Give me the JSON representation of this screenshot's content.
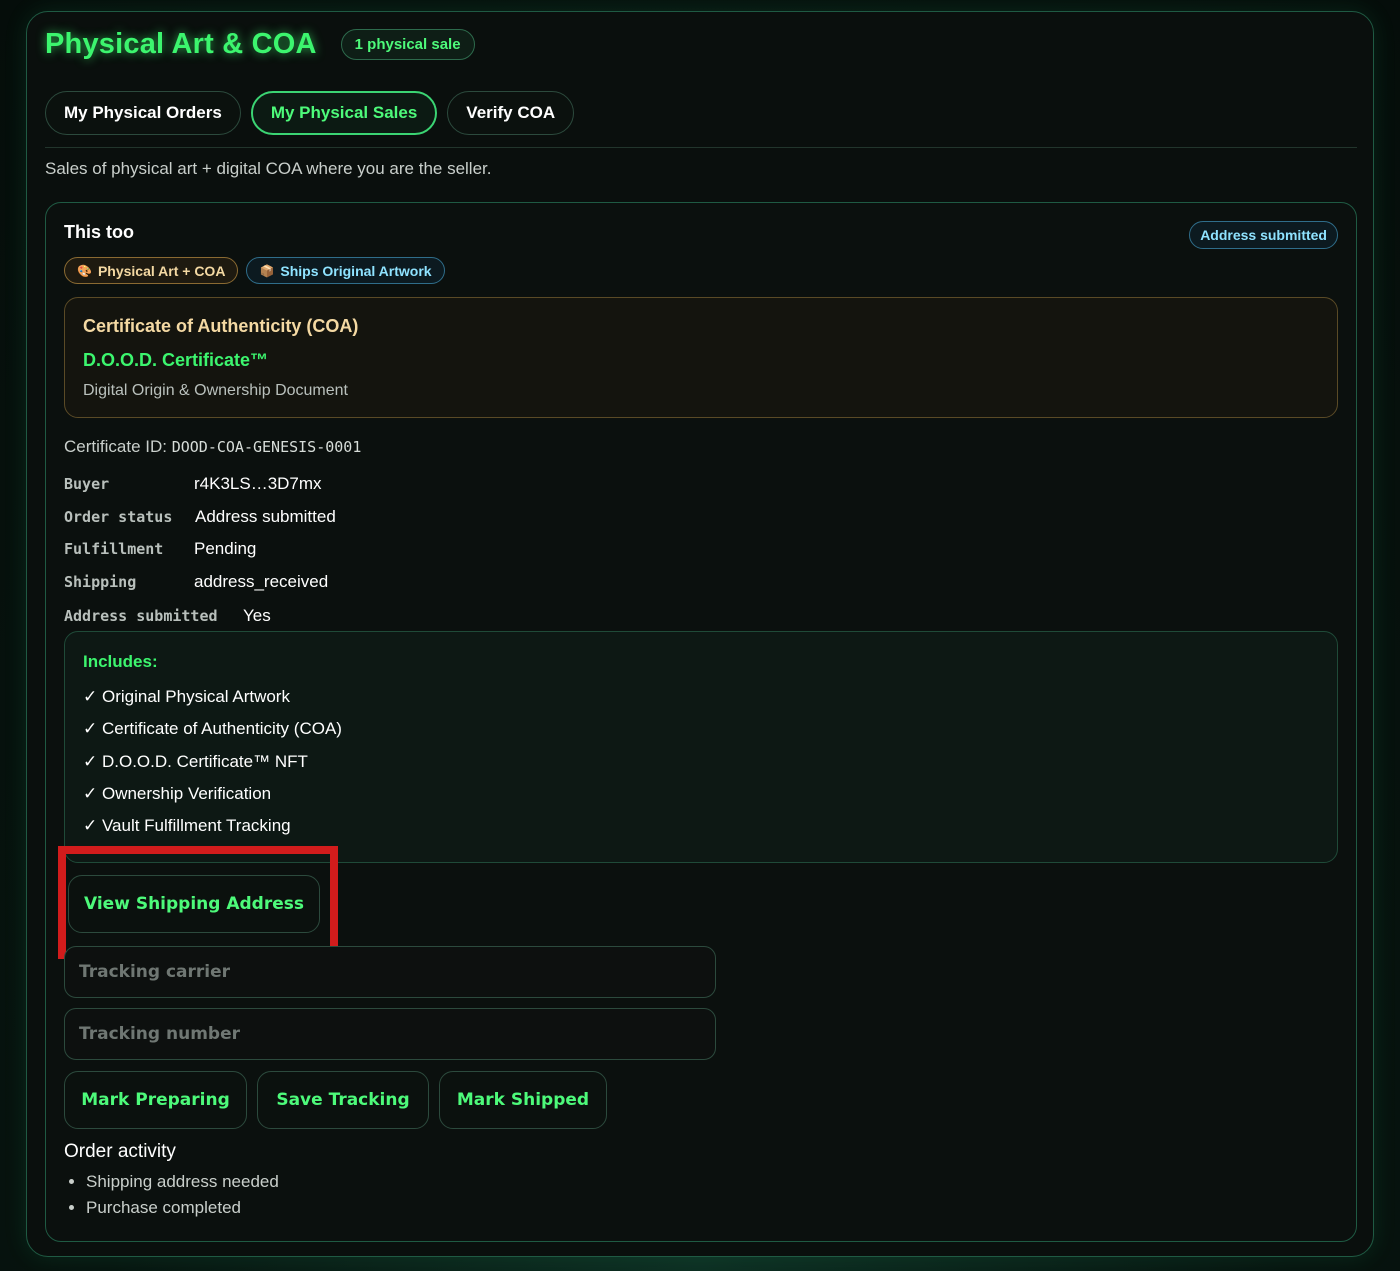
{
  "header": {
    "title": "Physical Art & COA",
    "count_badge": "1 physical sale"
  },
  "tabs": [
    {
      "label": "My Physical Orders",
      "active": false
    },
    {
      "label": "My Physical Sales",
      "active": true
    },
    {
      "label": "Verify COA",
      "active": false
    }
  ],
  "subtitle": "Sales of physical art + digital COA where you are the seller.",
  "sale": {
    "title": "This too",
    "status_badge": "Address submitted",
    "pills": [
      {
        "icon": "palette-icon",
        "glyph": "🎨",
        "label": "Physical Art + COA"
      },
      {
        "icon": "package-icon",
        "glyph": "📦",
        "label": "Ships Original Artwork"
      }
    ],
    "coa": {
      "heading": "Certificate of Authenticity (COA)",
      "name": "D.O.O.D. Certificate™",
      "description": "Digital Origin & Ownership Document"
    },
    "certificate_id_label": "Certificate ID:",
    "certificate_id": "DOOD-COA-GENESIS-0001",
    "details": [
      {
        "label": "Buyer",
        "value": "r4K3LS…3D7mx"
      },
      {
        "label": "Order status",
        "value": "Address submitted"
      },
      {
        "label": "Fulfillment",
        "value": "Pending"
      },
      {
        "label": "Shipping",
        "value": "address_received"
      },
      {
        "label": "Address submitted",
        "value": "Yes"
      }
    ],
    "includes": {
      "title": "Includes:",
      "items": [
        "✓ Original Physical Artwork",
        "✓ Certificate of Authenticity (COA)",
        "✓ D.O.O.D. Certificate™ NFT",
        "✓ Ownership Verification",
        "✓ Vault Fulfillment Tracking"
      ]
    },
    "view_shipping_label": "View Shipping Address",
    "tracking_carrier_placeholder": "Tracking carrier",
    "tracking_number_placeholder": "Tracking number",
    "actions": {
      "mark_preparing": "Mark Preparing",
      "save_tracking": "Save Tracking",
      "mark_shipped": "Mark Shipped"
    },
    "activity": {
      "title": "Order activity",
      "items": [
        "Shipping address needed",
        "Purchase completed"
      ]
    }
  },
  "colors": {
    "accent_green": "#3cf56e",
    "gold": "#f4d9a3",
    "info_blue": "#8fe3ff",
    "highlight_red": "#d21c1c"
  }
}
